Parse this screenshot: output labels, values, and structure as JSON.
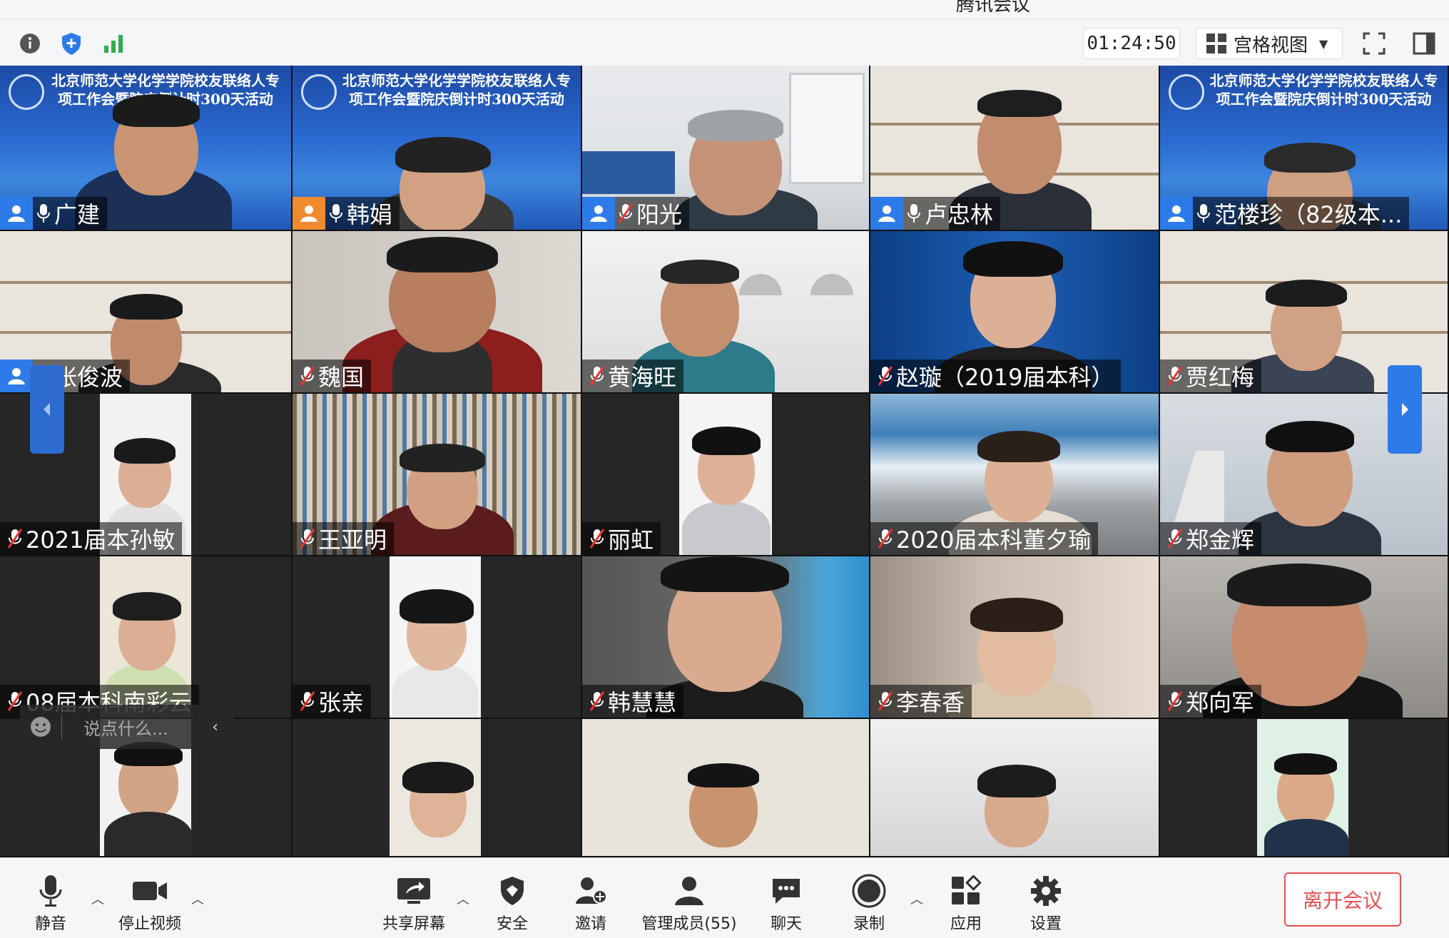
{
  "window": {
    "title": "腾讯会议"
  },
  "topbar": {
    "icons": [
      "info-icon",
      "shield-icon",
      "signal-icon",
      "fullscreen-icon",
      "sidebar-toggle-icon"
    ],
    "timer": "01:24:50",
    "view_mode": "宫格视图"
  },
  "banner_text": "北京师范大学化学学院校友联络人专项工作会暨院庆倒计时300天活动",
  "tiles": [
    {
      "name": "广建",
      "mic": "on",
      "host": true
    },
    {
      "name": "韩娟",
      "mic": "on",
      "host": true,
      "host_color": "#f08a2e"
    },
    {
      "name": "阳光",
      "mic": "muted",
      "host": true
    },
    {
      "name": "卢忠林",
      "mic": "on",
      "host": true
    },
    {
      "name": "范楼珍（82级本...",
      "mic": "on",
      "host": true
    },
    {
      "name": "张俊波",
      "mic": "muted",
      "host": true
    },
    {
      "name": "魏国",
      "mic": "muted",
      "host": false
    },
    {
      "name": "黄海旺",
      "mic": "muted",
      "host": false
    },
    {
      "name": "赵璇（2019届本科）",
      "mic": "muted",
      "host": false
    },
    {
      "name": "贾红梅",
      "mic": "muted",
      "host": false
    },
    {
      "name": "2021届本孙敏",
      "mic": "muted",
      "host": false
    },
    {
      "name": "王亚明",
      "mic": "muted",
      "host": false
    },
    {
      "name": "丽虹",
      "mic": "muted",
      "host": false
    },
    {
      "name": "2020届本科董夕瑜",
      "mic": "muted",
      "host": false
    },
    {
      "name": "郑金辉",
      "mic": "muted",
      "host": false
    },
    {
      "name": "08届本科南彩云",
      "mic": "muted",
      "host": false
    },
    {
      "name": "张亲",
      "mic": "muted",
      "host": false
    },
    {
      "name": "韩慧慧",
      "mic": "muted",
      "host": false
    },
    {
      "name": "李春香",
      "mic": "muted",
      "host": false
    },
    {
      "name": "郑向军",
      "mic": "muted",
      "host": false
    }
  ],
  "chat": {
    "placeholder": "说点什么..."
  },
  "toolbar": {
    "mute": "静音",
    "stop_video": "停止视频",
    "share_screen": "共享屏幕",
    "security": "安全",
    "invite": "邀请",
    "manage_members": "管理成员(55)",
    "chat": "聊天",
    "record": "录制",
    "apps": "应用",
    "settings": "设置",
    "leave": "离开会议"
  },
  "colors": {
    "accent": "#2d7be8",
    "leave": "#e65151",
    "host_badge": "#2d7be8"
  }
}
